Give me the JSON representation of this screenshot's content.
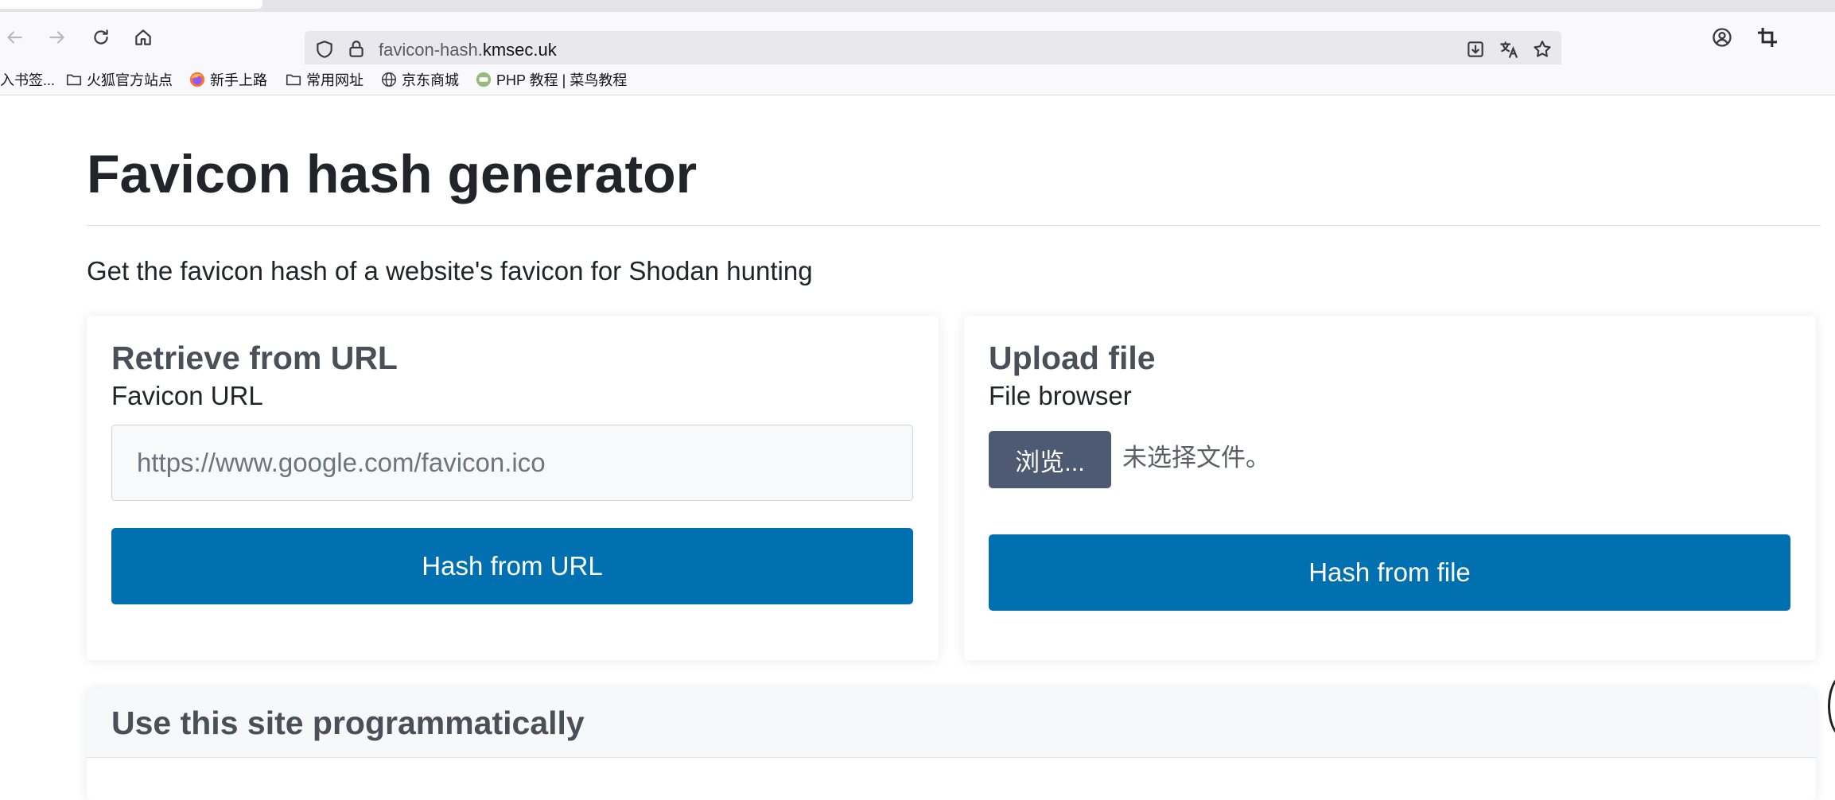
{
  "browser": {
    "url_prefix": "favicon-hash.",
    "url_host": "kmsec.uk",
    "bookmarks": [
      {
        "label": "入书签...",
        "icon": "none"
      },
      {
        "label": "火狐官方站点",
        "icon": "folder-icon"
      },
      {
        "label": "新手上路",
        "icon": "firefox-icon"
      },
      {
        "label": "常用网址",
        "icon": "folder-icon"
      },
      {
        "label": "京东商城",
        "icon": "globe-icon"
      },
      {
        "label": "PHP 教程 | 菜鸟教程",
        "icon": "runoob-icon"
      }
    ]
  },
  "page": {
    "title": "Favicon hash generator",
    "lead": "Get the favicon hash of a website's favicon for Shodan hunting"
  },
  "url_card": {
    "title": "Retrieve from URL",
    "label": "Favicon URL",
    "placeholder": "https://www.google.com/favicon.ico",
    "button": "Hash from URL"
  },
  "file_card": {
    "title": "Upload file",
    "label": "File browser",
    "browse_button": "浏览...",
    "status": "未选择文件。",
    "button": "Hash from file"
  },
  "programmatic": {
    "title": "Use this site programmatically"
  },
  "colors": {
    "primary": "#0070b0",
    "browse": "#4d5a72",
    "heading": "#212529",
    "card_heading": "#495057"
  }
}
